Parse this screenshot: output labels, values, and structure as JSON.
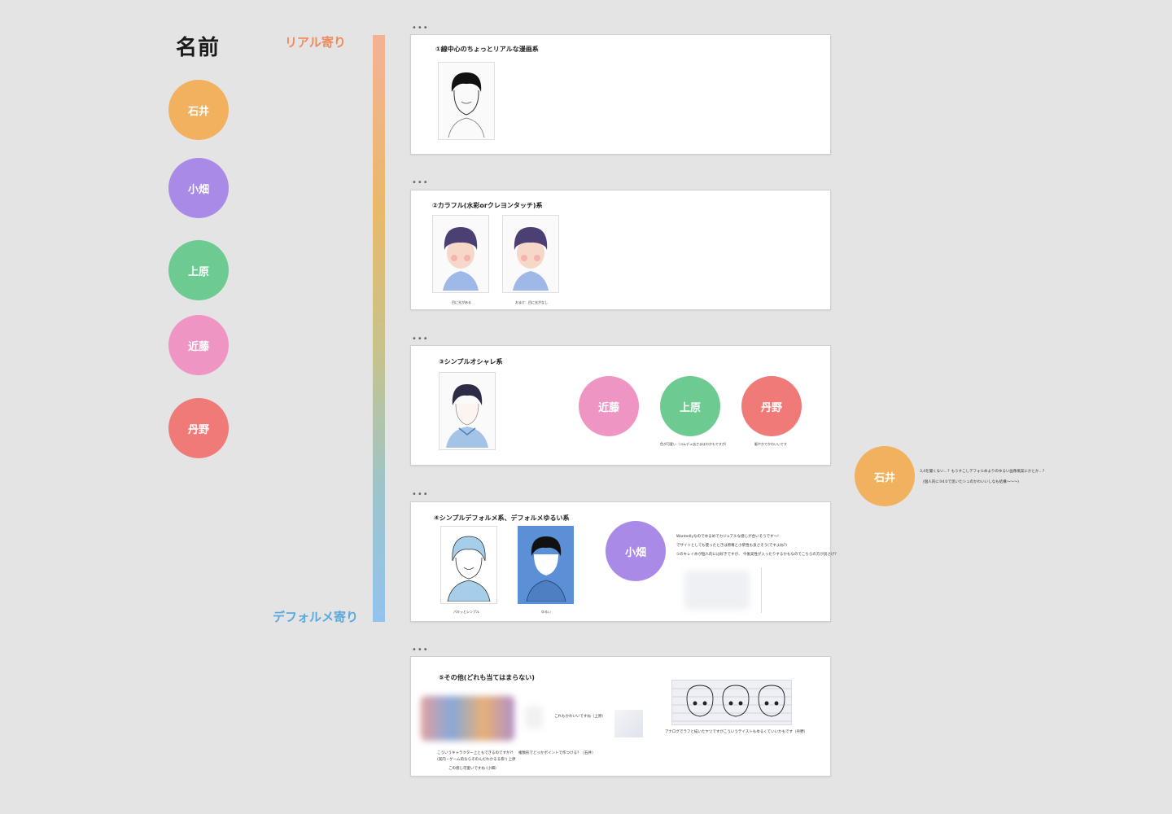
{
  "title": "名前",
  "members": [
    {
      "name": "石井",
      "color": "#f1b15e"
    },
    {
      "name": "小畑",
      "color": "#a98be7"
    },
    {
      "name": "上原",
      "color": "#6dcb91"
    },
    {
      "name": "近藤",
      "color": "#ef95c3"
    },
    {
      "name": "丹野",
      "color": "#ef7a78"
    }
  ],
  "scale": {
    "top_label": "リアル寄り",
    "bottom_label": "デフォルメ寄り"
  },
  "dots": "•••",
  "cards": [
    {
      "title": "①線中心のちょっとリアルな漫画系"
    },
    {
      "title": "②カラフル(水彩orクレヨンタッチ)系",
      "captions": [
        "目に光がある",
        "おまけ：目に光がなし"
      ]
    },
    {
      "title": "③シンプルオシャレ系",
      "votes": [
        {
          "name": "近藤",
          "note": ""
        },
        {
          "name": "上原",
          "note": "色が可愛い（コムデュ店さまはわかもですが）"
        },
        {
          "name": "丹野",
          "note": "賑やかでかわいいです"
        }
      ]
    },
    {
      "title": "④シンプルデフォルメ系、デフォルメゆるい系",
      "captions": [
        "パキッとシンプル",
        "ゆるい"
      ],
      "vote_name": "小畑",
      "notes": [
        "Wantedlyなのでゆるめでカジュアルな感じが合いそうです〜!",
        "でザイトとしても使ったときは原尊と小柴性も良さそう(ですよね?)",
        "①のキレイめが個人的には好きですが、 今後実性が入ったりするかもなのでこちらの方が良さげ?"
      ]
    },
    {
      "title": "⑤その他(どれも当てはまらない)",
      "notes": [
        "こういうキャラクター上ともできるのですか?!",
        "(案内・ゲーム的ならそのんだわかるる系!) 上原",
        "この感じ可愛いですね (小畑)",
        "これもかわいいですね（上原）",
        "複数形でどっかポイントで作つける？（石井）",
        "アナログでラフと描いたヤツですがこういうテイストもゆるくていいかもです（丹野）"
      ]
    }
  ],
  "side_comment": {
    "name": "石井",
    "lines": [
      "3,4を聞くない…？もうすこしデフォルめよりのゆるい画像風案にかとか…？",
      "(個人的に③4②で思いたシュのかわいいしなも結構〜〜〜)"
    ]
  }
}
